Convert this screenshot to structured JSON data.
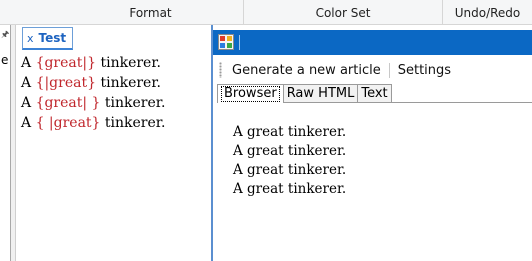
{
  "ribbon": {
    "groups": [
      "Format",
      "Color Set",
      "Undo/Redo"
    ]
  },
  "left_pane": {
    "pin_icon": "pin-icon",
    "clipped_text": "e"
  },
  "editor": {
    "tab_label": "Test",
    "close_glyph": "x",
    "lines": [
      {
        "before": "A ",
        "spin": "{great|}",
        "after": " tinkerer."
      },
      {
        "before": "A ",
        "spin": "{|great}",
        "after": " tinkerer."
      },
      {
        "before": "A ",
        "spin": "{great| }",
        "after": " tinkerer."
      },
      {
        "before": "A ",
        "spin": "{ |great}",
        "after": " tinkerer."
      }
    ],
    "spin_color": "#c0262c"
  },
  "preview": {
    "titlebar_color": "#0b68c4",
    "toolbar": {
      "generate_label": "Generate a new article",
      "settings_label": "Settings"
    },
    "tabs": [
      "Browser",
      "Raw HTML",
      "Text"
    ],
    "active_tab": "Browser",
    "browser_lines": [
      "A great tinkerer.",
      "A great tinkerer.",
      "A great tinkerer.",
      "A great tinkerer."
    ]
  }
}
